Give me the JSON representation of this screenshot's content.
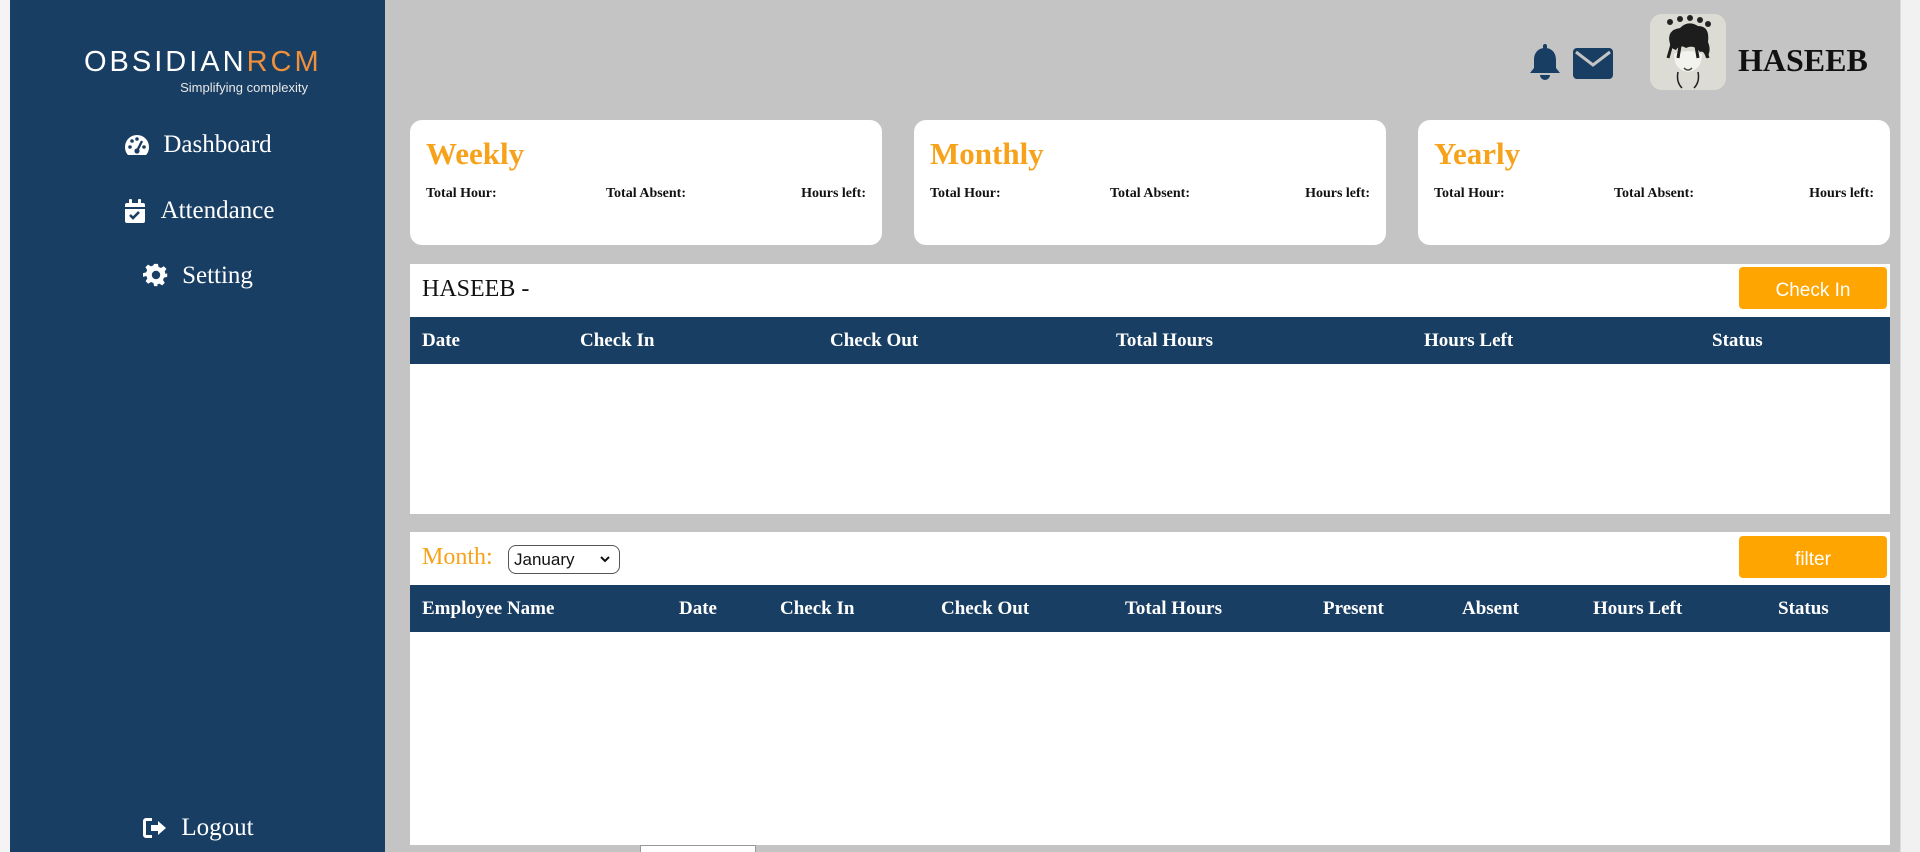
{
  "sidebar": {
    "logo_main_a": "OBSIDIAN",
    "logo_main_b": "RCM",
    "logo_tagline": "Simplifying complexity",
    "items": [
      {
        "label": "Dashboard",
        "icon": "gauge-icon"
      },
      {
        "label": "Attendance",
        "icon": "calendar-check-icon"
      },
      {
        "label": "Setting",
        "icon": "gear-icon"
      }
    ],
    "logout_label": "Logout"
  },
  "header": {
    "icons": [
      "bell-icon",
      "envelope-icon"
    ],
    "username": "HASEEB"
  },
  "cards": [
    {
      "title": "Weekly",
      "total_hour": "Total Hour:",
      "total_absent": "Total Absent:",
      "hours_left": "Hours left:"
    },
    {
      "title": "Monthly",
      "total_hour": "Total Hour:",
      "total_absent": "Total Absent:",
      "hours_left": "Hours left:"
    },
    {
      "title": "Yearly",
      "total_hour": "Total Hour:",
      "total_absent": "Total Absent:",
      "hours_left": "Hours left:"
    }
  ],
  "attendance": {
    "title": "HASEEB -",
    "check_in_button": "Check In",
    "columns": [
      "Date",
      "Check In",
      "Check Out",
      "Total Hours",
      "Hours Left",
      "Status"
    ],
    "rows": []
  },
  "report": {
    "month_label": "Month:",
    "month_value": "January",
    "filter_button": "filter",
    "columns": [
      "Employee Name",
      "Date",
      "Check In",
      "Check Out",
      "Total Hours",
      "Present",
      "Absent",
      "Hours Left",
      "Status"
    ],
    "rows": []
  },
  "colors": {
    "sidebar": "#193e63",
    "accent": "#f7a21b",
    "button": "#fea501",
    "background": "#c4c4c4"
  }
}
